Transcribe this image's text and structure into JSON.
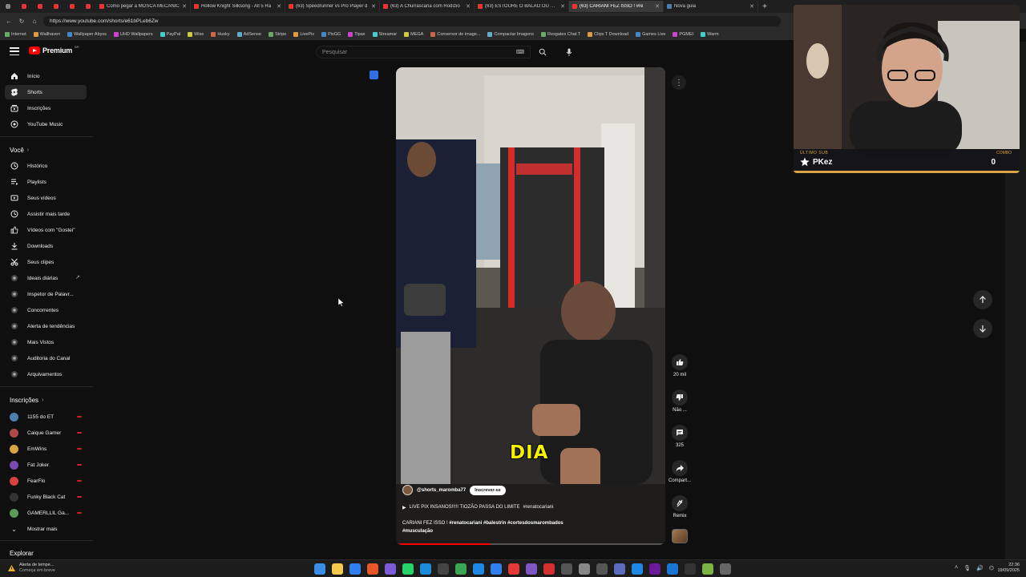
{
  "browser": {
    "tabs": [
      {
        "label": "Como pegar a MOSCA MECÂNIC",
        "active": false
      },
      {
        "label": "Hollow Knight Silksong - All 5 Ra",
        "active": false
      },
      {
        "label": "(63) Speedrunner vs Pro Player d",
        "active": false
      },
      {
        "label": "(63) A Churrascaria com Rodízio",
        "active": false
      },
      {
        "label": "(63) ESTOURE O BALÃO OU ENC",
        "active": false
      },
      {
        "label": "(63) CARIANI FEZ ISSO ! #re",
        "active": true
      },
      {
        "label": "Nova guia",
        "active": false
      }
    ],
    "url": "https://www.youtube.com/shorts/e61bPLeb6Zw",
    "bookmarks": [
      "Internet",
      "Wallhaven",
      "Wallpaper Abyss",
      "UHD Wallpapers",
      "PayPal",
      "Wise",
      "Husky",
      "AdSense",
      "Stripe",
      "LivePix",
      "PixGG",
      "Tipax",
      "Streamar",
      "MEGA",
      "Conversor de image...",
      "Compactar Imagens",
      "Resgates Chat T",
      "Clips T Download",
      "Games Live",
      "PGMEI",
      "Warm"
    ]
  },
  "header": {
    "logo_text": "Premium",
    "logo_country": "BR",
    "search_placeholder": "Pesquisar"
  },
  "sidebar": {
    "main": [
      {
        "label": "Início",
        "icon": "home-icon"
      },
      {
        "label": "Shorts",
        "icon": "shorts-icon",
        "active": true
      },
      {
        "label": "Inscrições",
        "icon": "subscriptions-icon"
      },
      {
        "label": "YouTube Music",
        "icon": "music-icon"
      }
    ],
    "you_title": "Você",
    "you": [
      {
        "label": "Histórico",
        "icon": "history-icon"
      },
      {
        "label": "Playlists",
        "icon": "playlists-icon"
      },
      {
        "label": "Seus vídeos",
        "icon": "your-videos-icon"
      },
      {
        "label": "Assistir mais tarde",
        "icon": "watch-later-icon"
      },
      {
        "label": "Vídeos com \"Gostei\"",
        "icon": "liked-icon"
      },
      {
        "label": "Downloads",
        "icon": "download-icon"
      },
      {
        "label": "Seus clipes",
        "icon": "clips-icon"
      },
      {
        "label": "Ideais diárias",
        "icon": "extension-icon"
      },
      {
        "label": "Inspetor de Palavr...",
        "icon": "extension-icon"
      },
      {
        "label": "Concorrentes",
        "icon": "extension-icon"
      },
      {
        "label": "Alerta de tendências",
        "icon": "extension-icon"
      },
      {
        "label": "Mais Vistos",
        "icon": "extension-icon"
      },
      {
        "label": "Auditoria do Canal",
        "icon": "extension-icon"
      },
      {
        "label": "Arquivamentos",
        "icon": "extension-icon"
      }
    ],
    "subs_title": "Inscrições",
    "subs": [
      {
        "label": "1155 do ET",
        "color": "#4a7fb0"
      },
      {
        "label": "Caique Gamer",
        "color": "#b04a4a"
      },
      {
        "label": "EmWins",
        "color": "#d9a441"
      },
      {
        "label": "Fat Joker",
        "color": "#7a4ab0"
      },
      {
        "label": "FearFlo",
        "color": "#d94141"
      },
      {
        "label": "Funky Black Cat",
        "color": "#333333"
      },
      {
        "label": "GAMERLLIL Ga...",
        "color": "#5a9a5a"
      }
    ],
    "show_more": "Mostrar mais",
    "explore_title": "Explorar"
  },
  "short": {
    "caption": "DIA",
    "channel": "@shorts_maromba77",
    "subscribe": "Inscrever-se",
    "live_text": "LIVE PIX INSANOS!!!!! TIOZÃO PASSA DO LIMITE",
    "live_tag": "#renatocariani",
    "desc_plain": "CARIANI FEZ ISSO !",
    "desc_tags": "#renatocariani #balestrin  #cortesdosmarombados",
    "desc_tags2": "#musculação",
    "progress": 0.35
  },
  "actions": {
    "likes": "20 mil",
    "dislike": "Não ...",
    "comments": "325",
    "share": "Compart...",
    "remix": "Remix"
  },
  "webcam": {
    "last_sub_label": "ÚLTIMO SUB",
    "last_sub_name": "PKez",
    "combo_label": "COMBO",
    "combo_value": "0"
  },
  "taskbar": {
    "weather_line1": "Alerta de tempe...",
    "weather_line2": "Começa em breve",
    "time": "22:36",
    "date": "19/09/2025"
  },
  "colors": {
    "accent": "#ff0000",
    "gold": "#d9a441",
    "caption_yellow": "#f4f000"
  }
}
